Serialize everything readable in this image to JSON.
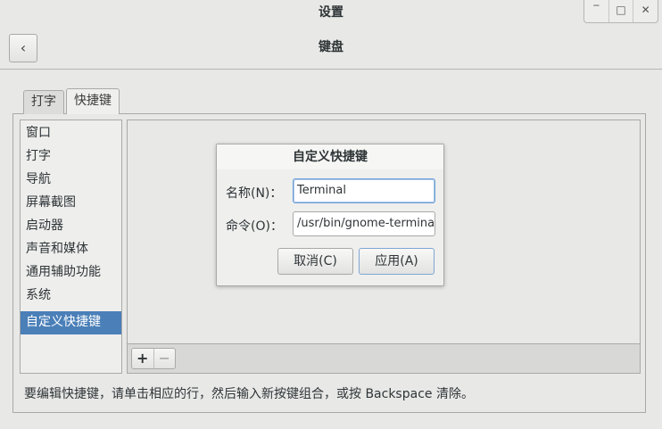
{
  "window": {
    "title": "设置",
    "controls": {
      "minimize": "‾",
      "maximize": "□",
      "close": "✕"
    }
  },
  "header": {
    "back_icon": "‹",
    "title": "键盘"
  },
  "tabs": [
    {
      "label": "打字"
    },
    {
      "label": "快捷键"
    }
  ],
  "categories": [
    {
      "label": "窗口"
    },
    {
      "label": "打字"
    },
    {
      "label": "导航"
    },
    {
      "label": "屏幕截图"
    },
    {
      "label": "启动器"
    },
    {
      "label": "声音和媒体"
    },
    {
      "label": "通用辅助功能"
    },
    {
      "label": "系统"
    },
    {
      "label": "自定义快捷键"
    }
  ],
  "toolbar": {
    "add_label": "+",
    "remove_label": "−"
  },
  "hint": "要编辑快捷键，请单击相应的行，然后输入新按键组合，或按 Backspace 清除。",
  "dialog": {
    "title": "自定义快捷键",
    "name_label": "名称(N)：",
    "name_value": "Terminal",
    "command_label": "命令(O)：",
    "command_value": "/usr/bin/gnome-terminal",
    "cancel_label": "取消(C)",
    "apply_label": "应用(A)"
  },
  "colors": {
    "selection": "#4a7fb8",
    "background": "#e8e8e7"
  }
}
